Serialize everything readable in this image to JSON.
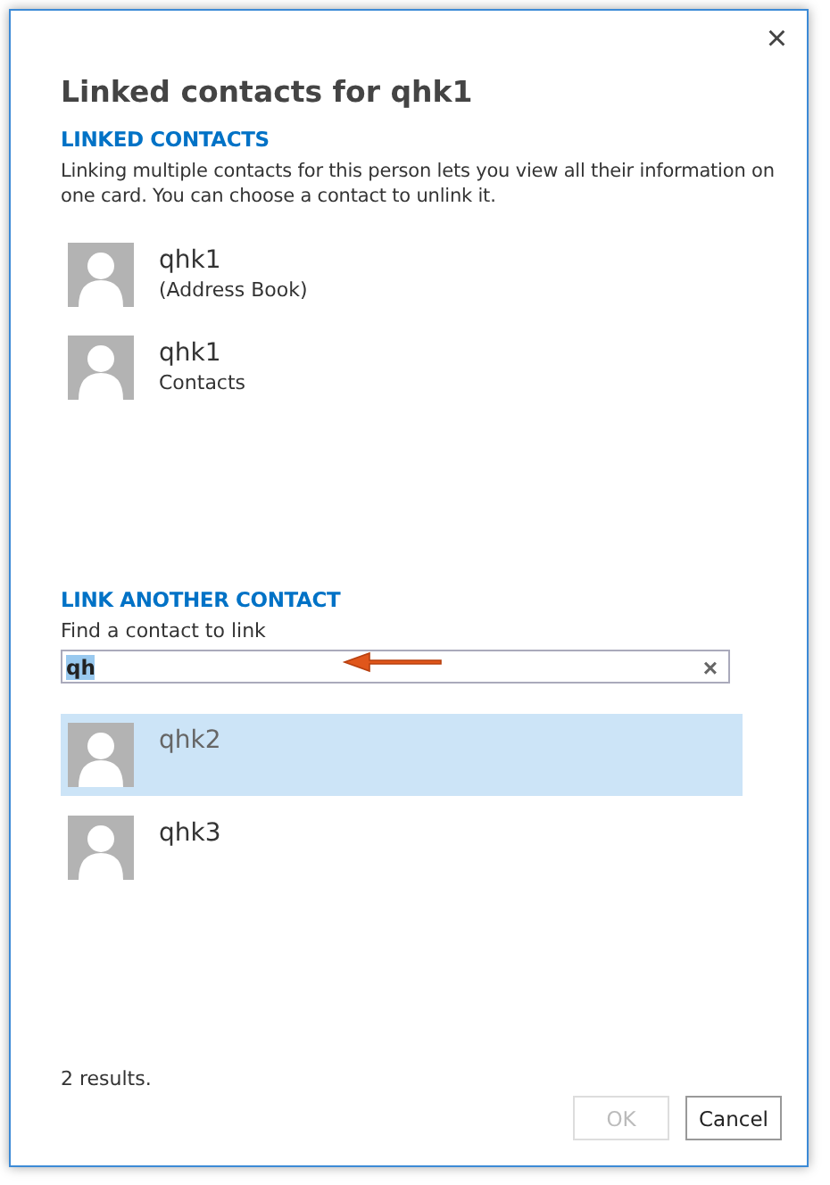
{
  "dialog": {
    "title": "Linked contacts for qhk1",
    "close": "×"
  },
  "linked": {
    "heading": "LINKED CONTACTS",
    "description": "Linking multiple contacts for this person lets you view all their information on one card. You can choose a contact to unlink it.",
    "contacts": [
      {
        "name": "qhk1",
        "source": "(Address Book)"
      },
      {
        "name": "qhk1",
        "source": "Contacts"
      }
    ]
  },
  "link_another": {
    "heading": "LINK ANOTHER CONTACT",
    "label": "Find a contact to link",
    "search": {
      "value": "qh",
      "text_selected": true,
      "clear": "×"
    },
    "results": [
      {
        "name": "qhk2",
        "selected": true
      },
      {
        "name": "qhk3",
        "selected": false
      }
    ]
  },
  "status": "2 results.",
  "buttons": [
    {
      "label": "OK",
      "disabled": true
    },
    {
      "label": "Cancel",
      "disabled": false
    }
  ]
}
